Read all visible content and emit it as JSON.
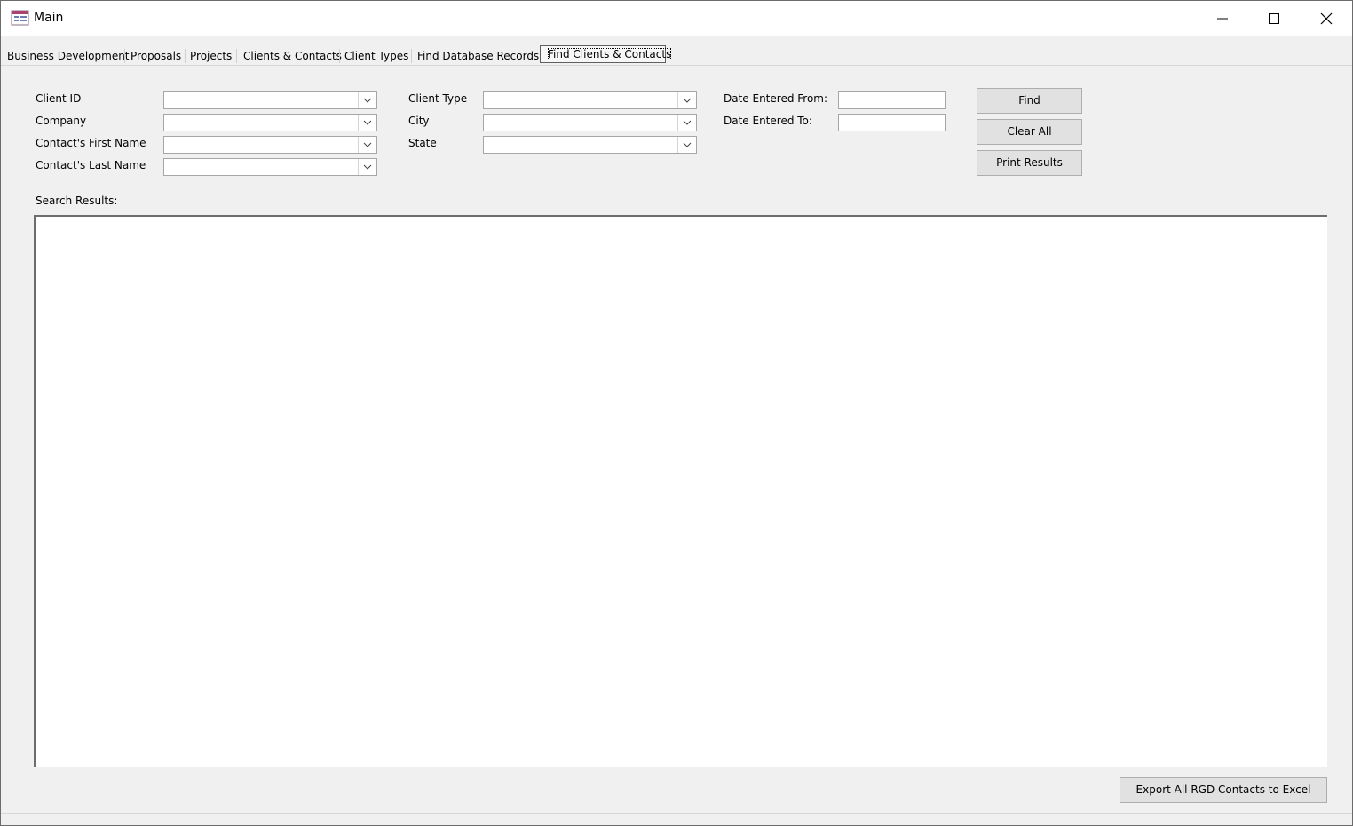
{
  "window": {
    "title": "Main",
    "controls": [
      "minimize-icon",
      "maximize-icon",
      "close-icon"
    ]
  },
  "tabs": [
    {
      "label": "Business Development"
    },
    {
      "label": "Proposals"
    },
    {
      "label": "Projects"
    },
    {
      "label": "Clients & Contacts"
    },
    {
      "label": "Client Types"
    },
    {
      "label": "Find Database Records"
    },
    {
      "label": "Find Clients & Contacts",
      "active": true
    }
  ],
  "form": {
    "client_id": {
      "label": "Client ID",
      "value": ""
    },
    "company": {
      "label": "Company",
      "value": ""
    },
    "first_name": {
      "label": "Contact's First Name",
      "value": ""
    },
    "last_name": {
      "label": "Contact's Last Name",
      "value": ""
    },
    "client_type": {
      "label": "Client Type",
      "value": ""
    },
    "city": {
      "label": "City",
      "value": ""
    },
    "state": {
      "label": "State",
      "value": ""
    },
    "date_from": {
      "label": "Date Entered From:",
      "value": ""
    },
    "date_to": {
      "label": "Date Entered To:",
      "value": ""
    }
  },
  "buttons": {
    "find": "Find",
    "clear_all": "Clear All",
    "print_results": "Print Results",
    "export": "Export All RGD Contacts to Excel"
  },
  "results": {
    "label": "Search Results:"
  }
}
